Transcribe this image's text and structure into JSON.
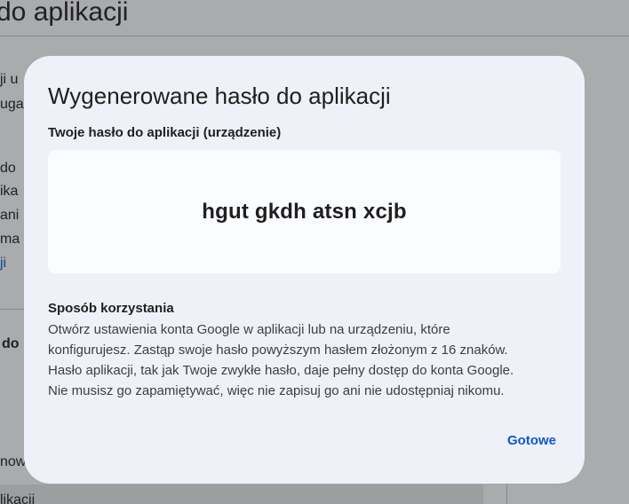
{
  "background": {
    "title": "do aplikacji",
    "fragments": [
      "ji u",
      "uga",
      "do",
      "ika",
      "ani",
      "ma",
      "ji",
      "do",
      "now",
      "likacji"
    ]
  },
  "dialog": {
    "title": "Wygenerowane hasło do aplikacji",
    "password_label": "Twoje hasło do aplikacji (urządzenie)",
    "password": "hgut gkdh atsn xcjb",
    "usage_heading": "Sposób korzystania",
    "usage_lines": [
      "Otwórz ustawienia konta Google w aplikacji lub na urządzeniu, które",
      "konfigurujesz. Zastąp swoje hasło powyższym hasłem złożonym z 16 znaków.",
      "Hasło aplikacji, tak jak Twoje zwykłe hasło, daje pełny dostęp do konta Google.",
      "Nie musisz go zapamiętywać, więc nie zapisuj go ani nie udostępniaj nikomu."
    ],
    "done_label": "Gotowe"
  }
}
